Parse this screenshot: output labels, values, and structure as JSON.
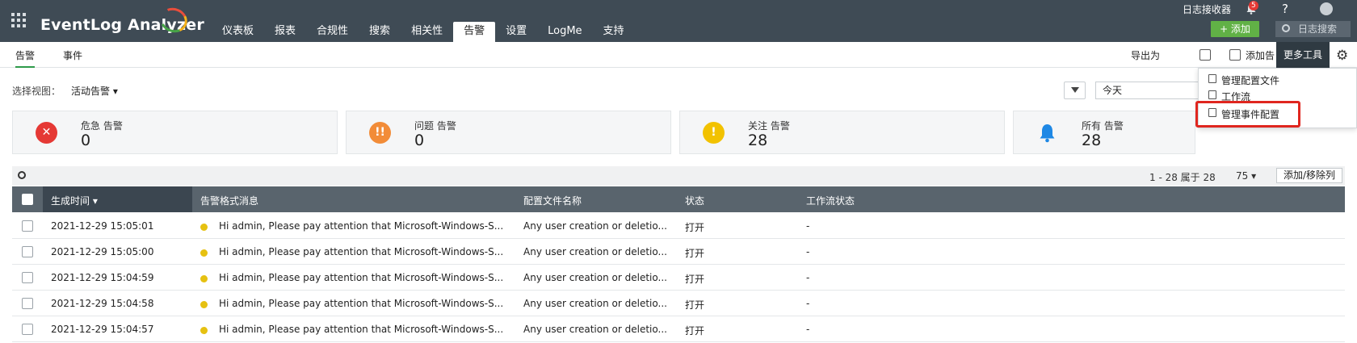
{
  "app": {
    "title": "EventLog Analyzer"
  },
  "nav": {
    "tabs": [
      "仪表板",
      "报表",
      "合规性",
      "搜索",
      "相关性",
      "告警",
      "设置",
      "LogMe",
      "支持"
    ],
    "active": "告警"
  },
  "topright": {
    "log_receiver": "日志接收器",
    "notifications": "5",
    "help": "?",
    "add_label": "+ 添加",
    "search_placeholder": "日志搜索"
  },
  "subnav": {
    "tabs": [
      "告警",
      "事件"
    ],
    "export": "导出为",
    "add_alert": "添加告",
    "tooltip": "更多工具"
  },
  "menu": {
    "items": [
      "管理配置文件",
      "工作流",
      "管理事件配置"
    ]
  },
  "view": {
    "label": "选择视图：",
    "selected": "活动告警"
  },
  "date": {
    "value": "今天"
  },
  "cards": [
    {
      "title": "危急 告警",
      "count": "0",
      "icon": "x",
      "color": "#e53935"
    },
    {
      "title": "问题 告警",
      "count": "0",
      "icon": "!!",
      "color": "#f28c38"
    },
    {
      "title": "关注 告警",
      "count": "28",
      "icon": "!",
      "color": "#f2c200"
    },
    {
      "title": "所有 告警",
      "count": "28",
      "icon": "bell",
      "color": "#1e88e5"
    }
  ],
  "table": {
    "paging": "1 - 28 属于 28",
    "page_size": "75",
    "add_remove_columns": "添加/移除列",
    "columns": [
      "生成时间",
      "告警格式消息",
      "配置文件名称",
      "状态",
      "工作流状态"
    ],
    "rows": [
      {
        "time": "2021-12-29 15:05:01",
        "message": "Hi admin, Please pay attention that Microsoft-Windows-S...",
        "profile": "Any user creation or deletio...",
        "status": "打开",
        "workflow": "-"
      },
      {
        "time": "2021-12-29 15:05:00",
        "message": "Hi admin, Please pay attention that Microsoft-Windows-S...",
        "profile": "Any user creation or deletio...",
        "status": "打开",
        "workflow": "-"
      },
      {
        "time": "2021-12-29 15:04:59",
        "message": "Hi admin, Please pay attention that Microsoft-Windows-S...",
        "profile": "Any user creation or deletio...",
        "status": "打开",
        "workflow": "-"
      },
      {
        "time": "2021-12-29 15:04:58",
        "message": "Hi admin, Please pay attention that Microsoft-Windows-S...",
        "profile": "Any user creation or deletio...",
        "status": "打开",
        "workflow": "-"
      },
      {
        "time": "2021-12-29 15:04:57",
        "message": "Hi admin, Please pay attention that Microsoft-Windows-S...",
        "profile": "Any user creation or deletio...",
        "status": "打开",
        "workflow": "-"
      }
    ]
  }
}
